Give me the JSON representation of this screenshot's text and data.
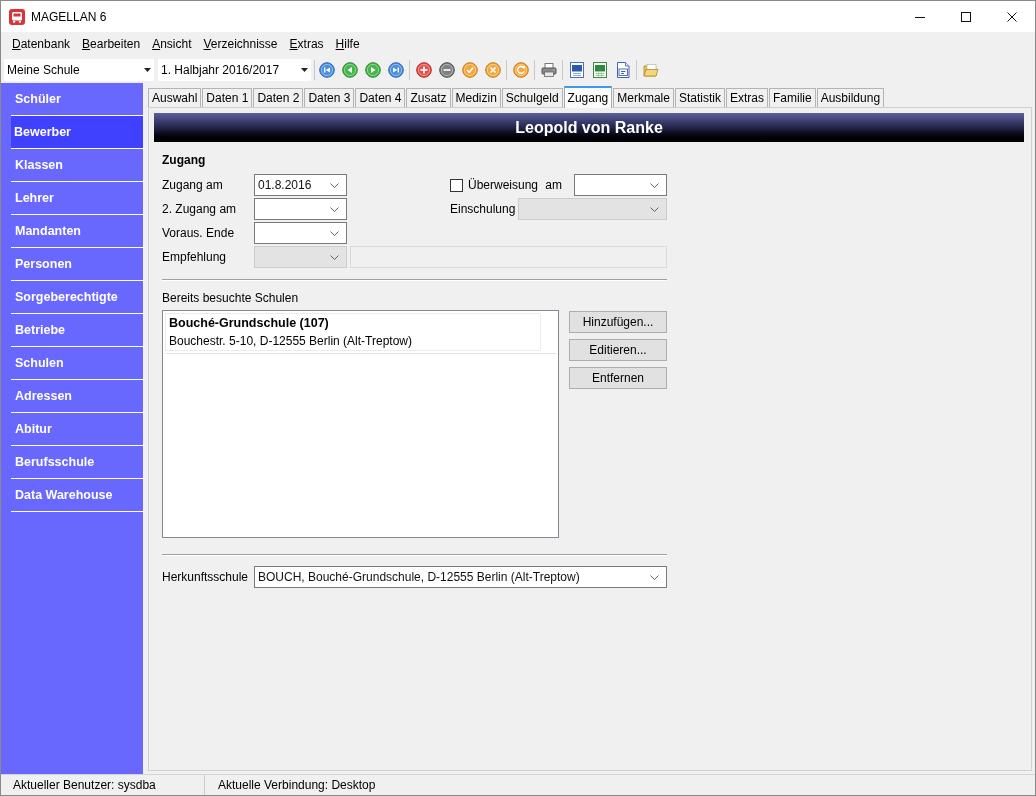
{
  "window": {
    "title": "MAGELLAN 6"
  },
  "menu": [
    "Datenbank",
    "Bearbeiten",
    "Ansicht",
    "Verzeichnisse",
    "Extras",
    "Hilfe"
  ],
  "toolbar": {
    "combos": [
      "Meine Schule",
      "1. Halbjahr 2016/2017"
    ]
  },
  "sidebar": {
    "items": [
      {
        "label": "Schüler",
        "selected": false
      },
      {
        "label": "Bewerber",
        "selected": true
      },
      {
        "label": "Klassen",
        "selected": false
      },
      {
        "label": "Lehrer",
        "selected": false
      },
      {
        "label": "Mandanten",
        "selected": false
      },
      {
        "label": "Personen",
        "selected": false
      },
      {
        "label": "Sorgeberechtigte",
        "selected": false
      },
      {
        "label": "Betriebe",
        "selected": false
      },
      {
        "label": "Schulen",
        "selected": false
      },
      {
        "label": "Adressen",
        "selected": false
      },
      {
        "label": "Abitur",
        "selected": false
      },
      {
        "label": "Berufsschule",
        "selected": false
      },
      {
        "label": "Data Warehouse",
        "selected": false
      }
    ]
  },
  "tabs": [
    {
      "label": "Auswahl",
      "selected": false
    },
    {
      "label": "Daten 1",
      "selected": false
    },
    {
      "label": "Daten 2",
      "selected": false
    },
    {
      "label": "Daten 3",
      "selected": false
    },
    {
      "label": "Daten 4",
      "selected": false
    },
    {
      "label": "Zusatz",
      "selected": false
    },
    {
      "label": "Medizin",
      "selected": false
    },
    {
      "label": "Schulgeld",
      "selected": false
    },
    {
      "label": "Zugang",
      "selected": true
    },
    {
      "label": "Merkmale",
      "selected": false
    },
    {
      "label": "Statistik",
      "selected": false
    },
    {
      "label": "Extras",
      "selected": false
    },
    {
      "label": "Familie",
      "selected": false
    },
    {
      "label": "Ausbildung",
      "selected": false
    }
  ],
  "record": {
    "title": "Leopold von Ranke"
  },
  "zugang": {
    "heading": "Zugang",
    "fields": [
      {
        "label": "Zugang am",
        "value": "01.8.2016",
        "disabled": false
      },
      {
        "label": "2. Zugang am",
        "disabled": false
      },
      {
        "label": "Voraus. Ende",
        "disabled": false
      },
      {
        "label": "Empfehlung",
        "disabled": true
      }
    ],
    "empfehlung_text": {
      "disabled": true
    },
    "ueberweisung": {
      "label": "Überweisung am",
      "checked": false,
      "disabled": false
    },
    "einschulung": {
      "label": "Einschulung",
      "disabled": true
    }
  },
  "schools": {
    "label": "Bereits besuchte Schulen",
    "items": [
      {
        "name": "Bouché-Grundschule (107)",
        "address": "Bouchestr. 5-10, D-12555 Berlin (Alt-Treptow)"
      }
    ],
    "buttons": [
      "Hinzufügen...",
      "Editieren...",
      "Entfernen"
    ]
  },
  "herkunftsschule": {
    "label": "Herkunftsschule",
    "value": "BOUCH, Bouché-Grundschule, D-12555 Berlin (Alt-Treptow)"
  },
  "status_bar": [
    "Aktueller Benutzer: sysdba",
    "Aktuelle Verbindung: Desktop"
  ]
}
